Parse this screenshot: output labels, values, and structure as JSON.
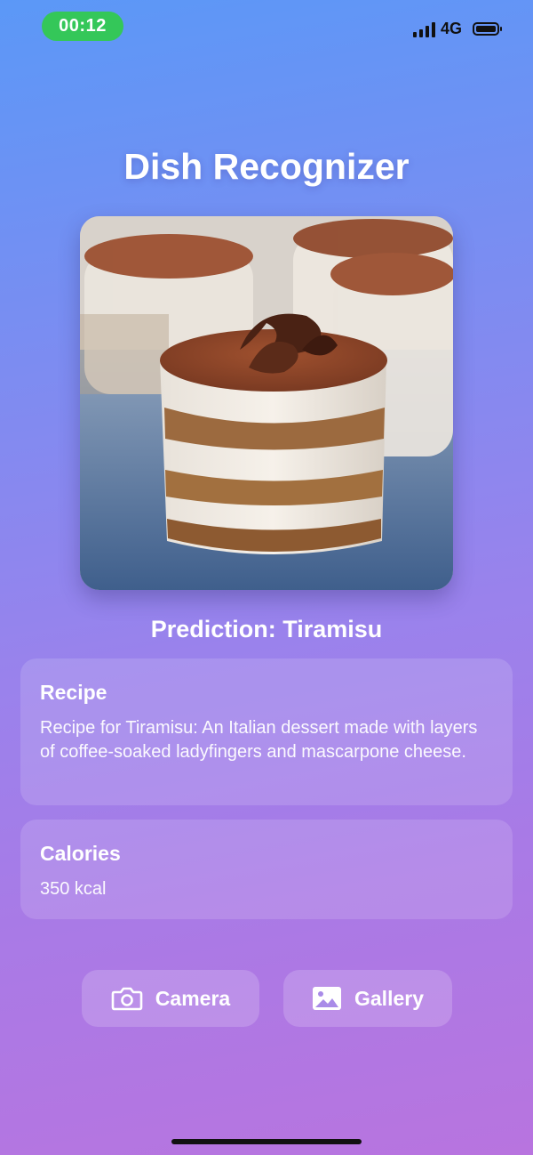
{
  "status_bar": {
    "time": "00:12",
    "network": "4G",
    "colors": {
      "time_pill": "#34c759"
    }
  },
  "app": {
    "title": "Dish Recognizer"
  },
  "photo": {
    "subject": "tiramisu-dessert-image"
  },
  "prediction": {
    "text": "Prediction: Tiramisu"
  },
  "recipe_card": {
    "title": "Recipe",
    "body": "Recipe for Tiramisu: An Italian dessert made with layers of coffee-soaked ladyfingers and mascarpone cheese."
  },
  "calories_card": {
    "title": "Calories",
    "body": "350 kcal"
  },
  "actions": {
    "camera_label": "Camera",
    "camera_icon": "camera-icon",
    "gallery_label": "Gallery",
    "gallery_icon": "image-icon"
  },
  "theme": {
    "gradient_top": "#5b98f7",
    "gradient_bottom": "#b874df"
  }
}
